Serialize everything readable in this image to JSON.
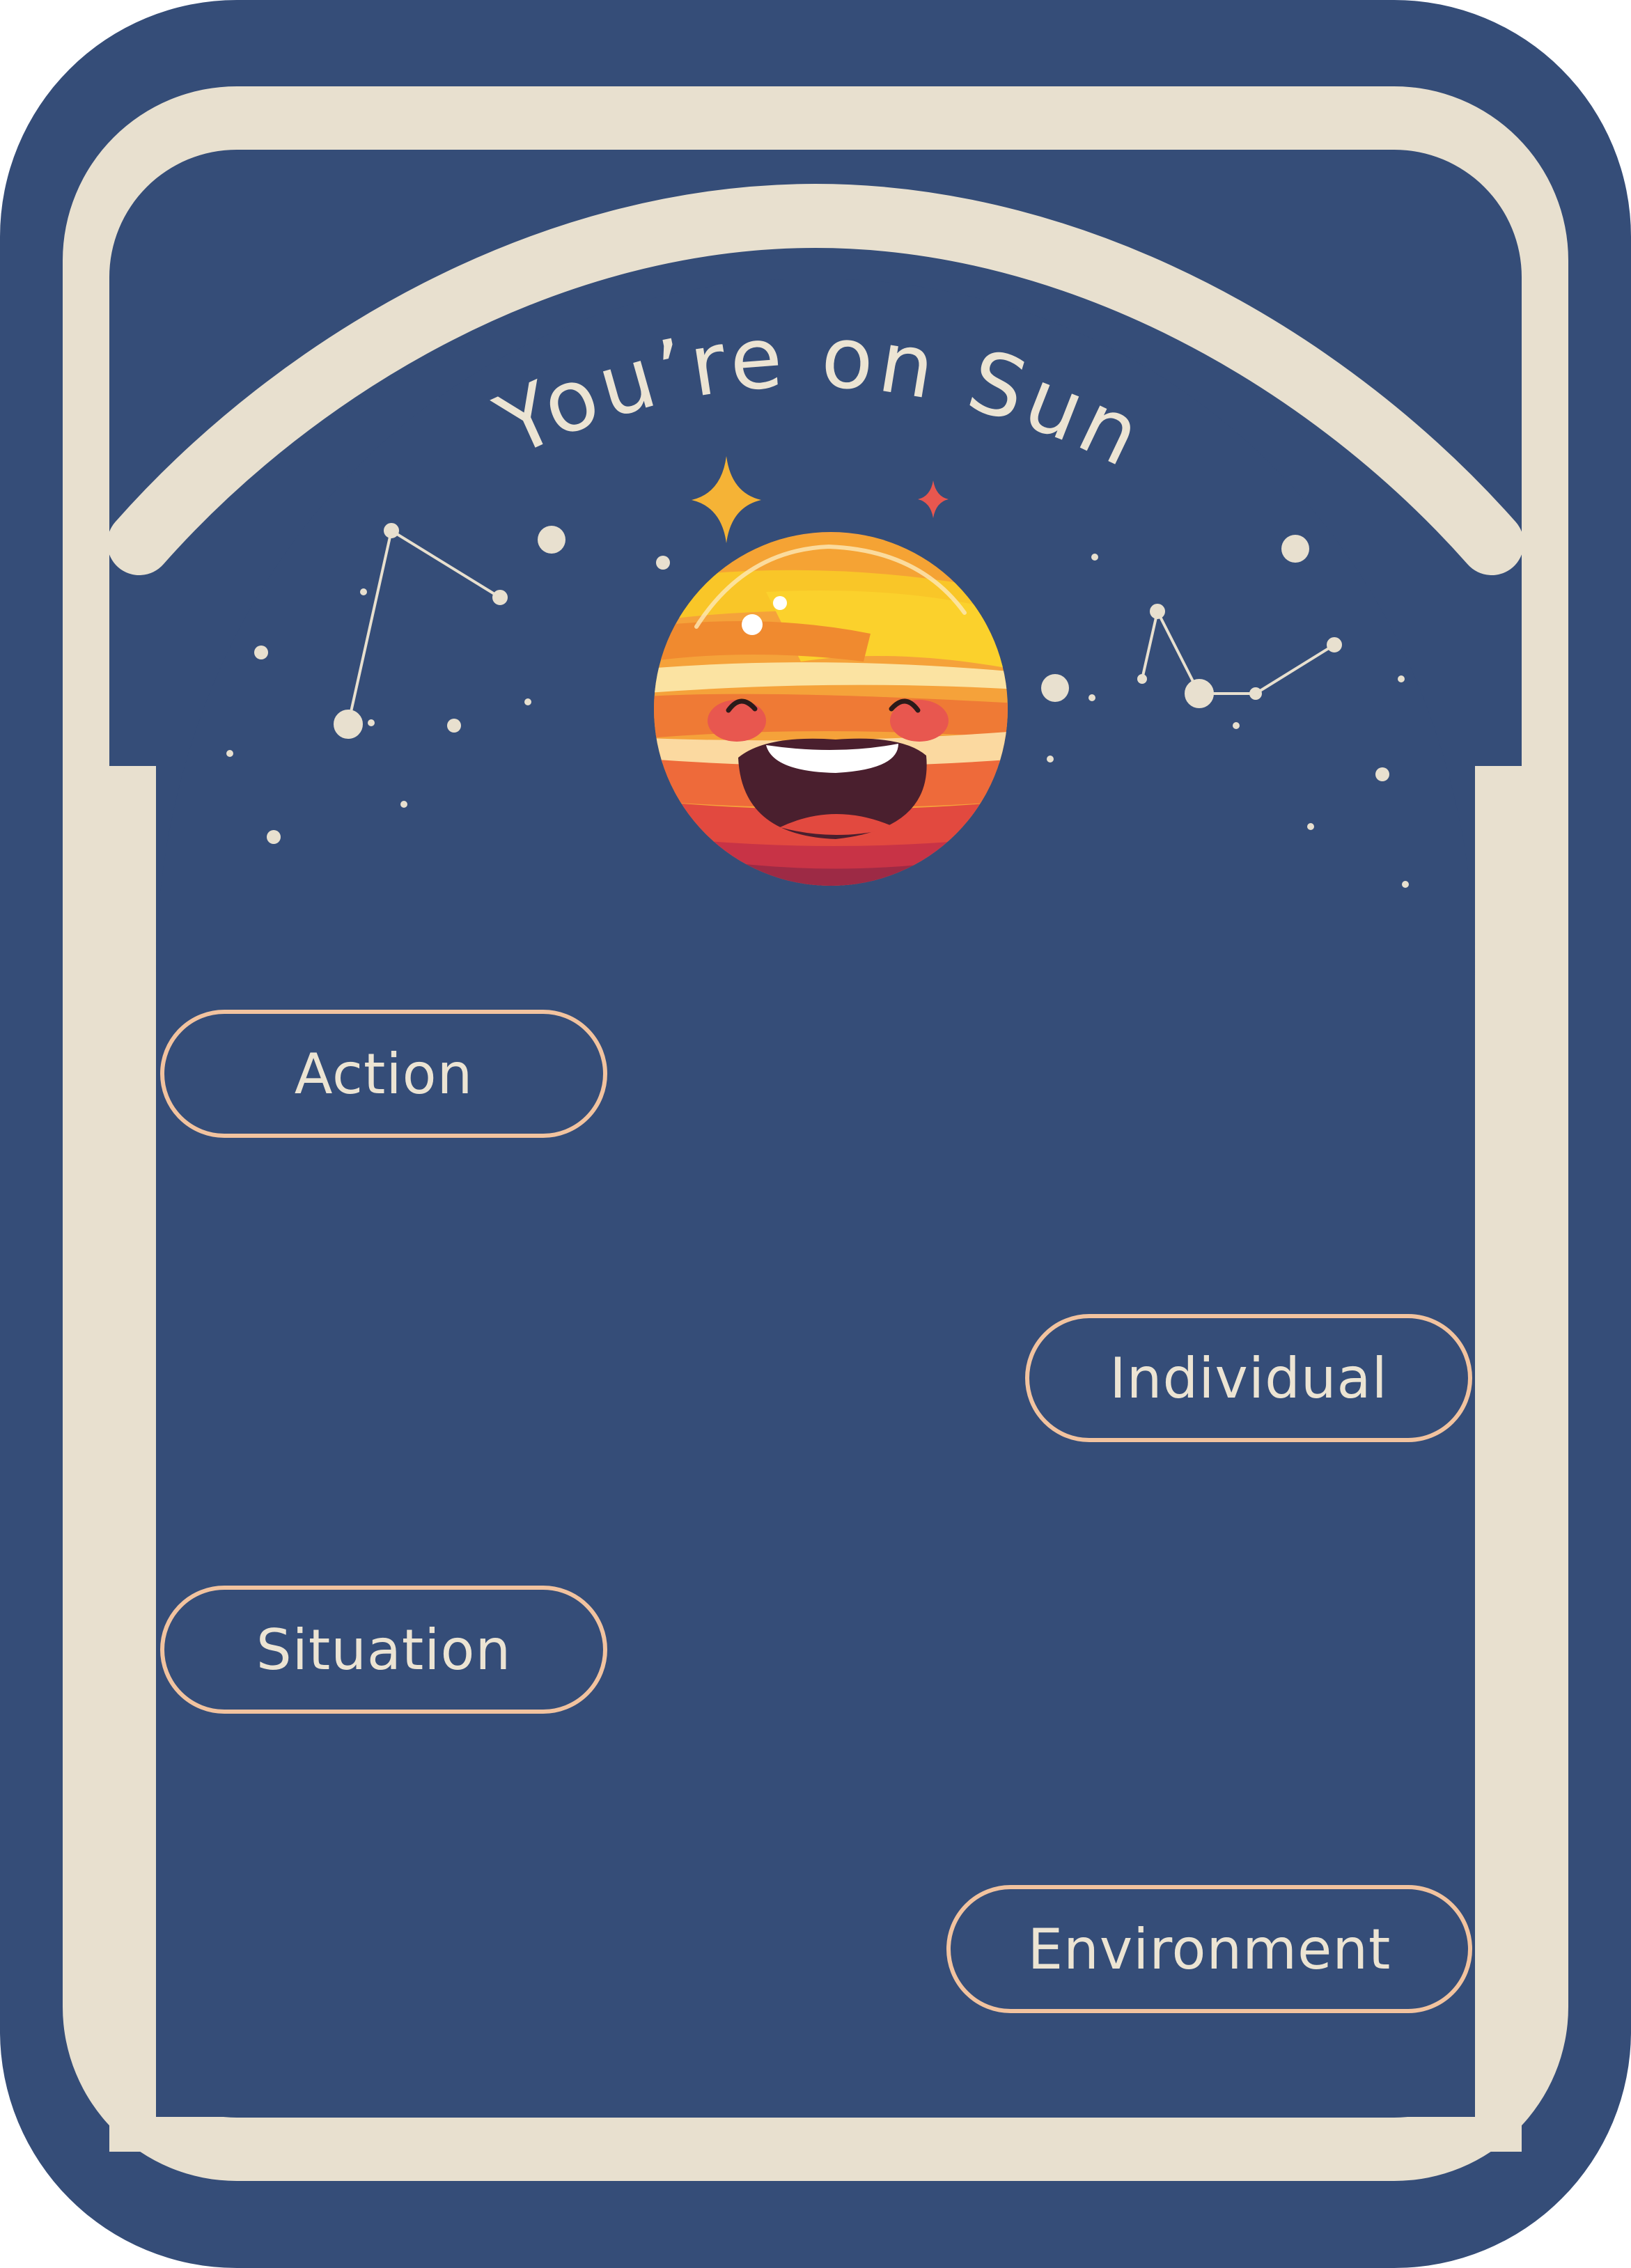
{
  "colors": {
    "navy": "#354d78",
    "cream": "#e8e0cf",
    "pill_border": "#f2c39f",
    "text": "#ece4d3",
    "star_gold": "#f5b336",
    "star_red": "#e8574f"
  },
  "card": {
    "title": "You’re on Sun"
  },
  "mascot": {
    "icon": "smiling-sun-icon"
  },
  "buttons": [
    {
      "label": "Action"
    },
    {
      "label": "Individual"
    },
    {
      "label": "Situation"
    },
    {
      "label": "Environment"
    }
  ]
}
